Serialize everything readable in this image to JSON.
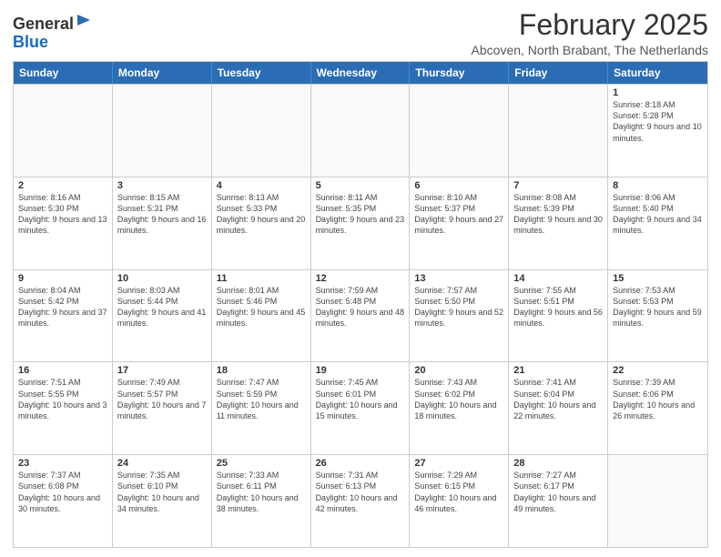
{
  "logo": {
    "general": "General",
    "blue": "Blue"
  },
  "header": {
    "month": "February 2025",
    "location": "Abcoven, North Brabant, The Netherlands"
  },
  "weekdays": [
    "Sunday",
    "Monday",
    "Tuesday",
    "Wednesday",
    "Thursday",
    "Friday",
    "Saturday"
  ],
  "rows": [
    [
      {
        "day": "",
        "info": ""
      },
      {
        "day": "",
        "info": ""
      },
      {
        "day": "",
        "info": ""
      },
      {
        "day": "",
        "info": ""
      },
      {
        "day": "",
        "info": ""
      },
      {
        "day": "",
        "info": ""
      },
      {
        "day": "1",
        "info": "Sunrise: 8:18 AM\nSunset: 5:28 PM\nDaylight: 9 hours and 10 minutes."
      }
    ],
    [
      {
        "day": "2",
        "info": "Sunrise: 8:16 AM\nSunset: 5:30 PM\nDaylight: 9 hours and 13 minutes."
      },
      {
        "day": "3",
        "info": "Sunrise: 8:15 AM\nSunset: 5:31 PM\nDaylight: 9 hours and 16 minutes."
      },
      {
        "day": "4",
        "info": "Sunrise: 8:13 AM\nSunset: 5:33 PM\nDaylight: 9 hours and 20 minutes."
      },
      {
        "day": "5",
        "info": "Sunrise: 8:11 AM\nSunset: 5:35 PM\nDaylight: 9 hours and 23 minutes."
      },
      {
        "day": "6",
        "info": "Sunrise: 8:10 AM\nSunset: 5:37 PM\nDaylight: 9 hours and 27 minutes."
      },
      {
        "day": "7",
        "info": "Sunrise: 8:08 AM\nSunset: 5:39 PM\nDaylight: 9 hours and 30 minutes."
      },
      {
        "day": "8",
        "info": "Sunrise: 8:06 AM\nSunset: 5:40 PM\nDaylight: 9 hours and 34 minutes."
      }
    ],
    [
      {
        "day": "9",
        "info": "Sunrise: 8:04 AM\nSunset: 5:42 PM\nDaylight: 9 hours and 37 minutes."
      },
      {
        "day": "10",
        "info": "Sunrise: 8:03 AM\nSunset: 5:44 PM\nDaylight: 9 hours and 41 minutes."
      },
      {
        "day": "11",
        "info": "Sunrise: 8:01 AM\nSunset: 5:46 PM\nDaylight: 9 hours and 45 minutes."
      },
      {
        "day": "12",
        "info": "Sunrise: 7:59 AM\nSunset: 5:48 PM\nDaylight: 9 hours and 48 minutes."
      },
      {
        "day": "13",
        "info": "Sunrise: 7:57 AM\nSunset: 5:50 PM\nDaylight: 9 hours and 52 minutes."
      },
      {
        "day": "14",
        "info": "Sunrise: 7:55 AM\nSunset: 5:51 PM\nDaylight: 9 hours and 56 minutes."
      },
      {
        "day": "15",
        "info": "Sunrise: 7:53 AM\nSunset: 5:53 PM\nDaylight: 9 hours and 59 minutes."
      }
    ],
    [
      {
        "day": "16",
        "info": "Sunrise: 7:51 AM\nSunset: 5:55 PM\nDaylight: 10 hours and 3 minutes."
      },
      {
        "day": "17",
        "info": "Sunrise: 7:49 AM\nSunset: 5:57 PM\nDaylight: 10 hours and 7 minutes."
      },
      {
        "day": "18",
        "info": "Sunrise: 7:47 AM\nSunset: 5:59 PM\nDaylight: 10 hours and 11 minutes."
      },
      {
        "day": "19",
        "info": "Sunrise: 7:45 AM\nSunset: 6:01 PM\nDaylight: 10 hours and 15 minutes."
      },
      {
        "day": "20",
        "info": "Sunrise: 7:43 AM\nSunset: 6:02 PM\nDaylight: 10 hours and 18 minutes."
      },
      {
        "day": "21",
        "info": "Sunrise: 7:41 AM\nSunset: 6:04 PM\nDaylight: 10 hours and 22 minutes."
      },
      {
        "day": "22",
        "info": "Sunrise: 7:39 AM\nSunset: 6:06 PM\nDaylight: 10 hours and 26 minutes."
      }
    ],
    [
      {
        "day": "23",
        "info": "Sunrise: 7:37 AM\nSunset: 6:08 PM\nDaylight: 10 hours and 30 minutes."
      },
      {
        "day": "24",
        "info": "Sunrise: 7:35 AM\nSunset: 6:10 PM\nDaylight: 10 hours and 34 minutes."
      },
      {
        "day": "25",
        "info": "Sunrise: 7:33 AM\nSunset: 6:11 PM\nDaylight: 10 hours and 38 minutes."
      },
      {
        "day": "26",
        "info": "Sunrise: 7:31 AM\nSunset: 6:13 PM\nDaylight: 10 hours and 42 minutes."
      },
      {
        "day": "27",
        "info": "Sunrise: 7:29 AM\nSunset: 6:15 PM\nDaylight: 10 hours and 46 minutes."
      },
      {
        "day": "28",
        "info": "Sunrise: 7:27 AM\nSunset: 6:17 PM\nDaylight: 10 hours and 49 minutes."
      },
      {
        "day": "",
        "info": ""
      }
    ]
  ]
}
